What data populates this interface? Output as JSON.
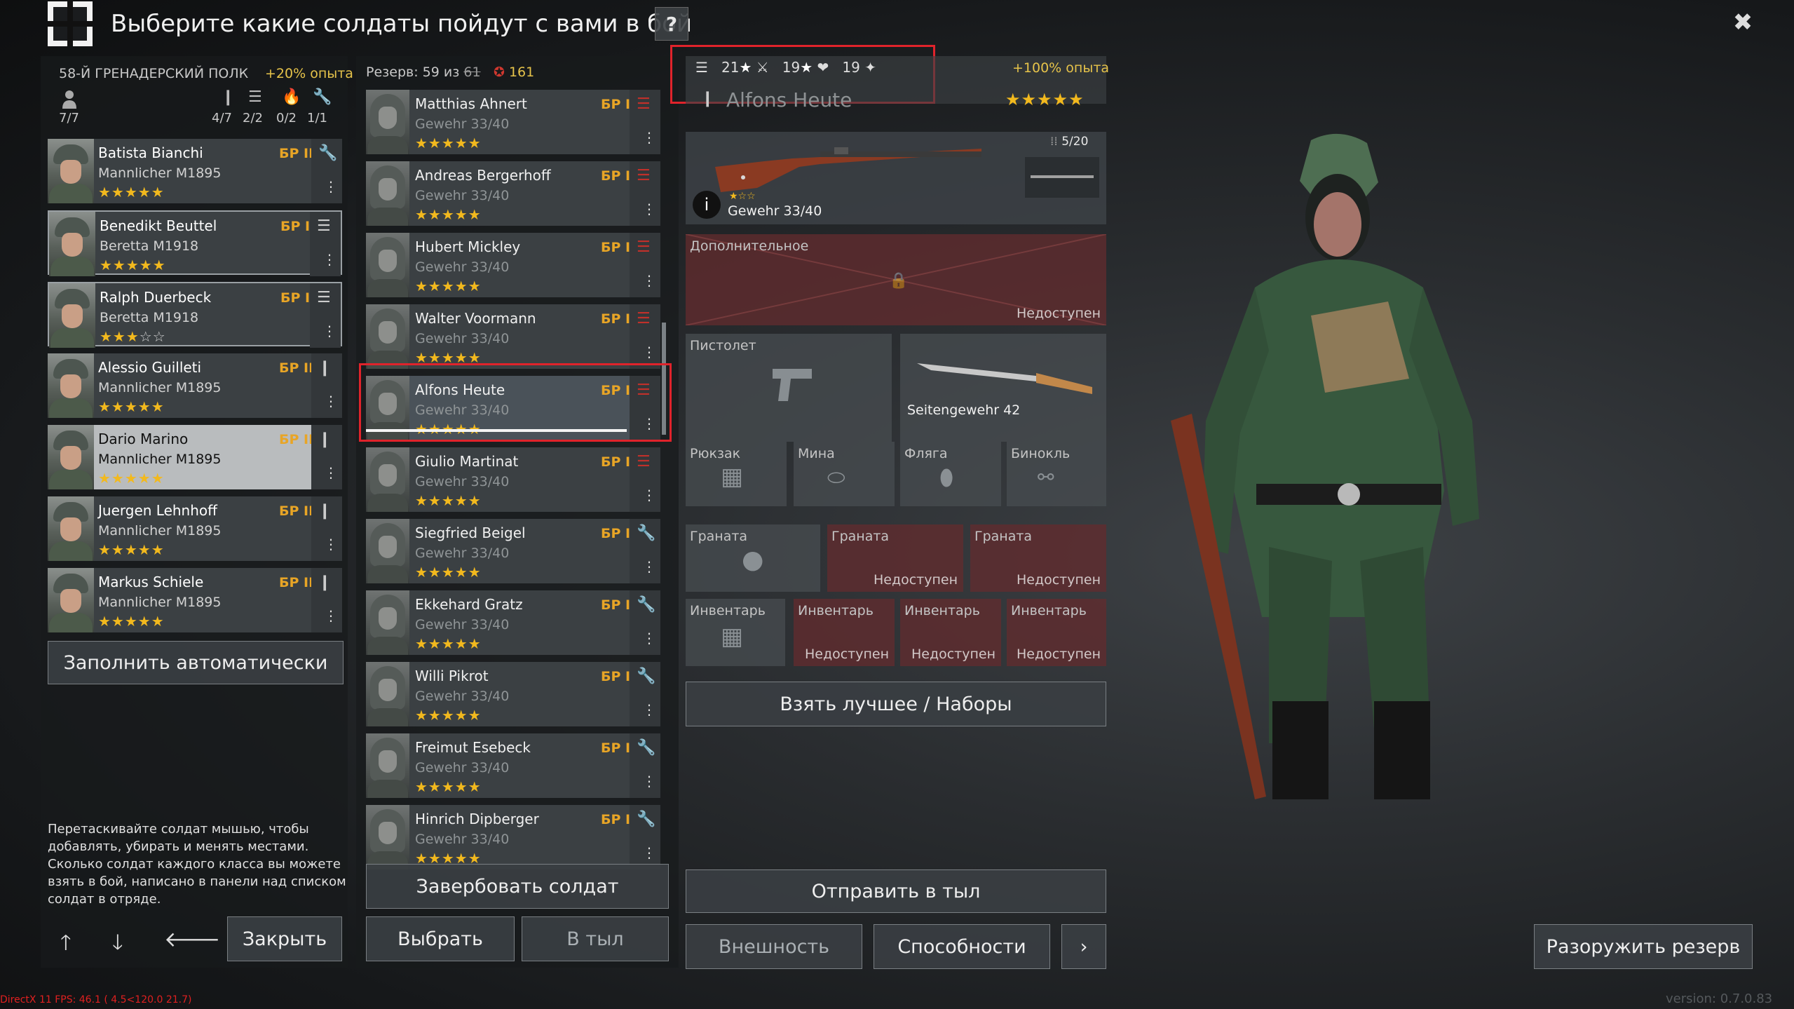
{
  "header": {
    "title": "Выберите какие солдаты пойдут с вами в бой",
    "help": "?",
    "close": "✖"
  },
  "squad": {
    "name": "58-Й ГРЕНАДЕРСКИЙ ПОЛК",
    "xp_bonus": "+20% опыта",
    "capacity": [
      {
        "icon": "soldier-icon",
        "value": "7/7"
      },
      {
        "icon": "rifleman-icon",
        "value": "4/7"
      },
      {
        "icon": "radio-icon",
        "value": "2/2"
      },
      {
        "icon": "flamethrower-icon",
        "value": "0/2"
      },
      {
        "icon": "engineer-icon",
        "value": "1/1"
      }
    ],
    "soldiers": [
      {
        "name": "Batista Bianchi",
        "weapon": "Mannlicher M1895",
        "rank": "БР II",
        "stars": 5,
        "class_icon": "wrench-icon"
      },
      {
        "name": "Benedikt Beuttel",
        "weapon": "Beretta M1918",
        "rank": "БР II",
        "stars": 5,
        "class_icon": "radio-icon"
      },
      {
        "name": "Ralph Duerbeck",
        "weapon": "Beretta M1918",
        "rank": "БР II",
        "stars": 3,
        "class_icon": "radio-icon"
      },
      {
        "name": "Alessio Guilleti",
        "weapon": "Mannlicher M1895",
        "rank": "БР II",
        "stars": 5,
        "class_icon": "rifle-icon"
      },
      {
        "name": "Dario Marino",
        "weapon": "Mannlicher M1895",
        "rank": "БР II",
        "stars": 5,
        "class_icon": "rifle-icon"
      },
      {
        "name": "Juergen Lehnhoff",
        "weapon": "Mannlicher M1895",
        "rank": "БР II",
        "stars": 5,
        "class_icon": "rifle-icon"
      },
      {
        "name": "Markus Schiele",
        "weapon": "Mannlicher M1895",
        "rank": "БР II",
        "stars": 5,
        "class_icon": "rifle-icon"
      }
    ],
    "autofill_label": "Заполнить автоматически",
    "help_text": "Перетаскивайте солдат мышью, чтобы добавлять, убирать и менять местами. Сколько солдат каждого класса вы можете взять в бой, написано в панели над списком солдат в отряде.",
    "close_label": "Закрыть"
  },
  "reserve": {
    "label": "Резерв: 59 из",
    "struck_count": "61",
    "medal_count": "161",
    "soldiers": [
      {
        "name": "Matthias Ahnert",
        "weapon": "Gewehr 33/40",
        "rank": "БР I",
        "stars": 5
      },
      {
        "name": "Andreas Bergerhoff",
        "weapon": "Gewehr 33/40",
        "rank": "БР I",
        "stars": 5
      },
      {
        "name": "Hubert Mickley",
        "weapon": "Gewehr 33/40",
        "rank": "БР I",
        "stars": 5
      },
      {
        "name": "Walter Voormann",
        "weapon": "Gewehr 33/40",
        "rank": "БР I",
        "stars": 5
      },
      {
        "name": "Alfons Heute",
        "weapon": "Gewehr 33/40",
        "rank": "БР I",
        "stars": 5
      },
      {
        "name": "Giulio Martinat",
        "weapon": "Gewehr 33/40",
        "rank": "БР I",
        "stars": 5
      },
      {
        "name": "Siegfried Beigel",
        "weapon": "Gewehr 33/40",
        "rank": "БР I",
        "stars": 5
      },
      {
        "name": "Ekkehard Gratz",
        "weapon": "Gewehr 33/40",
        "rank": "БР I",
        "stars": 5
      },
      {
        "name": "Willi Pikrot",
        "weapon": "Gewehr 33/40",
        "rank": "БР I",
        "stars": 5
      },
      {
        "name": "Freimut Esebeck",
        "weapon": "Gewehr 33/40",
        "rank": "БР I",
        "stars": 5
      },
      {
        "name": "Hinrich Dipberger",
        "weapon": "Gewehr 33/40",
        "rank": "БР I",
        "stars": 5
      }
    ],
    "recruit_label": "Завербовать солдат",
    "select_label": "Выбрать",
    "to_rear_label": "В тыл"
  },
  "details": {
    "stats": {
      "a": "21",
      "b": "19",
      "c": "19"
    },
    "xp_bonus": "+100% опыта",
    "soldier_name": "Alfons Heute",
    "stars": 5,
    "primary": {
      "name": "Gewehr 33/40",
      "ammo": "5/20"
    },
    "slots": {
      "extra": "Дополнительное",
      "unavailable": "Недоступен",
      "pistol": "Пистолет",
      "melee": "Seitengewehr 42",
      "backpack": "Рюкзак",
      "mine": "Мина",
      "flask": "Фляга",
      "binoculars": "Бинокль",
      "grenade": "Граната",
      "inventory": "Инвентарь"
    },
    "best_label": "Взять лучшее / Наборы",
    "send_rear_label": "Отправить в тыл",
    "appearance_label": "Внешность",
    "abilities_label": "Способности",
    "next_label": "›"
  },
  "disarm_label": "Разоружить резерв",
  "footer": {
    "debug": "DirectX 11 FPS: 46.1 ( 4.5<120.0 21.7)",
    "version": "version: 0.7.0.83"
  },
  "colors": {
    "accent_gold": "#f2b91e",
    "rank_orange": "#e8a526",
    "locked_red": "#622c2e",
    "highlight_red": "#e0232b"
  }
}
